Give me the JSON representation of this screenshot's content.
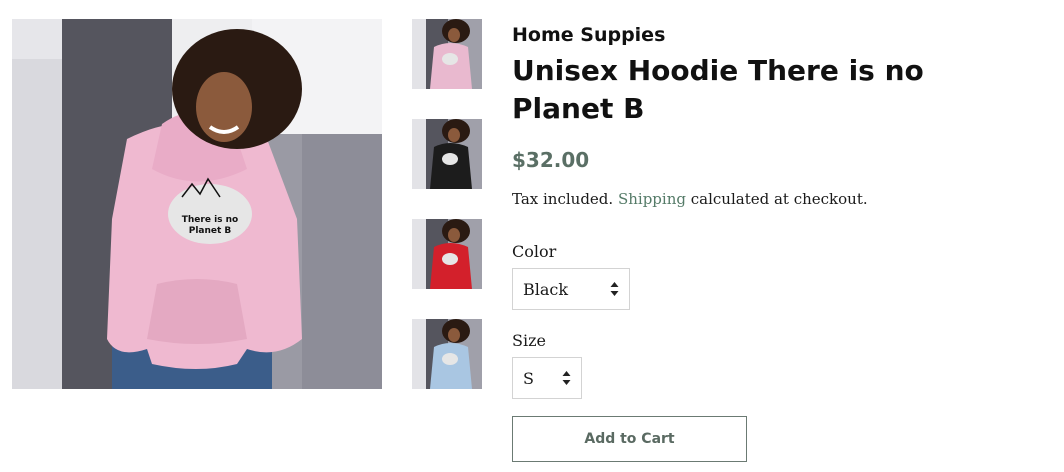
{
  "product": {
    "vendor": "Home Suppies",
    "title": "Unisex Hoodie There is no Planet B",
    "price": "$32.00",
    "tax_prefix": "Tax included.",
    "tax_link": "Shipping",
    "tax_suffix": "calculated at checkout.",
    "print_text_line1": "There is no",
    "print_text_line2": "Planet B"
  },
  "options": {
    "color_label": "Color",
    "color_value": "Black",
    "size_label": "Size",
    "size_value": "S"
  },
  "cart": {
    "add_label": "Add to Cart"
  },
  "thumbnails": [
    {
      "name": "pink",
      "hoodie_color": "#e9b9cf"
    },
    {
      "name": "black",
      "hoodie_color": "#1c1c1c"
    },
    {
      "name": "red",
      "hoodie_color": "#d3202b"
    },
    {
      "name": "light-blue",
      "hoodie_color": "#a9c6e2"
    }
  ],
  "colors": {
    "price": "#5a6f65",
    "link": "#557b68",
    "button_border": "#6b7a73"
  }
}
